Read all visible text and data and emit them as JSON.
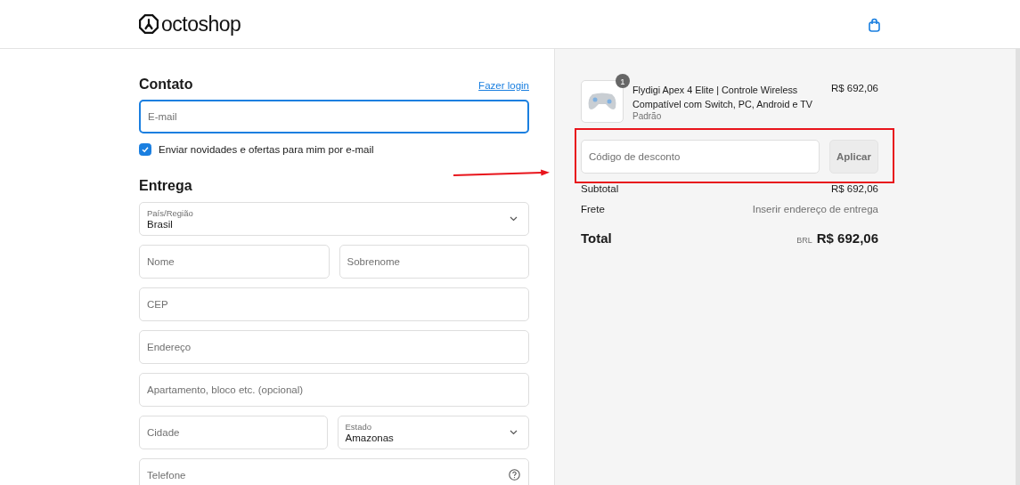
{
  "header": {
    "logo": "octoshop"
  },
  "contact": {
    "title": "Contato",
    "login_link": "Fazer login",
    "email": {
      "placeholder": "E-mail",
      "focused": true
    },
    "newsletter": {
      "label": "Enviar novidades e ofertas para mim por e-mail",
      "checked": true
    }
  },
  "delivery": {
    "title": "Entrega",
    "rows": [
      [
        {
          "kind": "select",
          "label": "País/Região",
          "value": "Brasil"
        }
      ],
      [
        {
          "kind": "text",
          "placeholder": "Nome"
        },
        {
          "kind": "text",
          "placeholder": "Sobrenome"
        }
      ],
      [
        {
          "kind": "text",
          "placeholder": "CEP"
        }
      ],
      [
        {
          "kind": "text",
          "placeholder": "Endereço"
        }
      ],
      [
        {
          "kind": "text",
          "placeholder": "Apartamento, bloco etc. (opcional)"
        }
      ],
      [
        {
          "kind": "text",
          "placeholder": "Cidade"
        },
        {
          "kind": "select",
          "label": "Estado",
          "value": "Amazonas"
        }
      ],
      [
        {
          "kind": "help",
          "placeholder": "Telefone"
        }
      ]
    ]
  },
  "summary": {
    "item": {
      "quantity": "1",
      "name": "Flydigi Apex 4 Elite | Controle Wireless Compatível com Switch, PC, Android e TV",
      "variant": "Padrão",
      "price": "R$ 692,06"
    },
    "discount": {
      "placeholder": "Código de desconto",
      "button": "Aplicar"
    },
    "lines": [
      {
        "label": "Subtotal",
        "value": "R$ 692,06",
        "muted": false
      },
      {
        "label": "Frete",
        "value": "Inserir endereço de entrega",
        "muted": true
      }
    ],
    "total": {
      "label": "Total",
      "currency": "BRL",
      "value": "R$ 692,06"
    }
  }
}
